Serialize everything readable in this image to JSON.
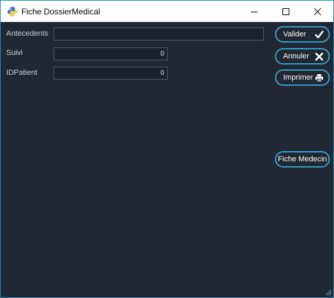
{
  "window": {
    "title": "Fiche DossierMedical"
  },
  "form": {
    "fields": [
      {
        "label": "Antecedents",
        "value": ""
      },
      {
        "label": "Suivi",
        "value": "0"
      },
      {
        "label": "IDPatient",
        "value": "0"
      }
    ]
  },
  "buttons": {
    "valider": "Valider",
    "annuler": "Annuler",
    "imprimer": "Imprimer",
    "fiche_medecin": "Fiche Medecin"
  },
  "icons": {
    "app": "python-icon",
    "valider": "check-icon",
    "annuler": "close-icon",
    "imprimer": "printer-icon"
  },
  "colors": {
    "background": "#222833",
    "accent": "#2f9ec9",
    "input_border": "#4f5764",
    "label_text": "#c9ccd2"
  }
}
